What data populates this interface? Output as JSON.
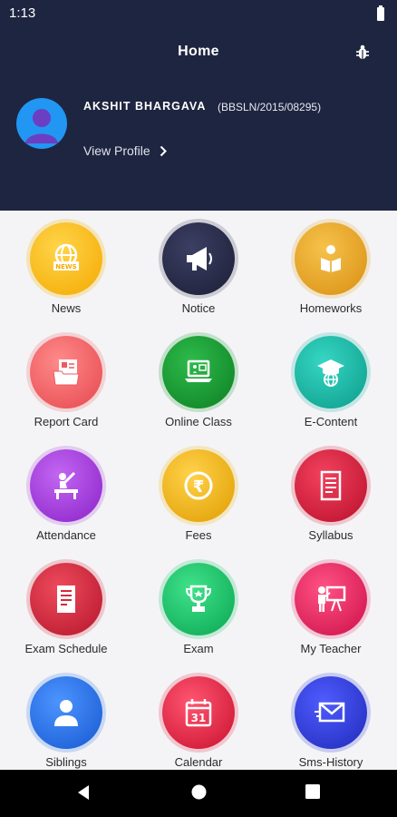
{
  "status": {
    "time": "1:13"
  },
  "appbar": {
    "title": "Home"
  },
  "profile": {
    "name": "AKSHIT  BHARGAVA",
    "id": "(BBSLN/2015/08295)",
    "view_label": "View Profile"
  },
  "menu": [
    {
      "label": "News",
      "icon": "news-icon",
      "color": "#f4b400"
    },
    {
      "label": "Notice",
      "icon": "megaphone-icon",
      "color": "#2c2f4f"
    },
    {
      "label": "Homeworks",
      "icon": "student-reading-icon",
      "color": "#e3a523"
    },
    {
      "label": "Report Card",
      "icon": "report-card-folder-icon",
      "color": "#ee5a5f"
    },
    {
      "label": "Online Class",
      "icon": "laptop-icon",
      "color": "#159a2f"
    },
    {
      "label": "E-Content",
      "icon": "graduation-globe-icon",
      "color": "#17b8a6"
    },
    {
      "label": "Attendance",
      "icon": "desk-student-icon",
      "color": "#a23fd8"
    },
    {
      "label": "Fees",
      "icon": "rupee-coin-icon",
      "color": "#f3b400"
    },
    {
      "label": "Syllabus",
      "icon": "document-icon",
      "color": "#d91f3c"
    },
    {
      "label": "Exam Schedule",
      "icon": "exam-document-icon",
      "color": "#d4293d"
    },
    {
      "label": "Exam",
      "icon": "trophy-icon",
      "color": "#17c267"
    },
    {
      "label": "My Teacher",
      "icon": "teacher-board-icon",
      "color": "#ea2a62"
    },
    {
      "label": "Siblings",
      "icon": "person-icon",
      "color": "#2876ec"
    },
    {
      "label": "Calendar",
      "icon": "calendar-icon",
      "color": "#ec2445"
    },
    {
      "label": "Sms-History",
      "icon": "envelope-icon",
      "color": "#2f3fd9"
    }
  ],
  "calendar_day": "31"
}
